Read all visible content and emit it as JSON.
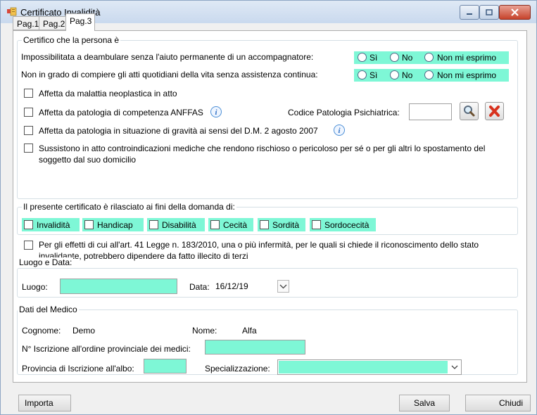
{
  "window": {
    "title": "Certificato Invalidità"
  },
  "tabs": [
    "Pag.1",
    "Pag.2",
    "Pag.3"
  ],
  "certifico": {
    "group_title": "Certifico che la persona è",
    "question1": "Impossibilitata a deambulare senza l'aiuto permanente di un accompagnatore:",
    "question2": "Non in grado di compiere gli atti quotidiani della vita senza assistenza continua:",
    "radio_options": [
      "Sì",
      "No",
      "Non mi esprimo"
    ],
    "check1": "Affetta da malattia neoplastica in atto",
    "check2": "Affetta da patologia di competenza ANFFAS",
    "codice_label": "Codice Patologia Psichiatrica:",
    "codice_value": "",
    "check3": "Affetta da patologia in situazione di gravità ai sensi del D.M. 2 agosto 2007",
    "check4_line1": "Sussistono in atto controindicazioni mediche che rendono rischioso o pericoloso per sé o per gli altri lo spostamento del",
    "check4_line2": "soggetto dal suo domicilio"
  },
  "domanda": {
    "group_title": "Il presente certificato è rilasciato ai fini della domanda di:",
    "options": [
      "Invalidità",
      "Handicap",
      "Disabilità",
      "Cecità",
      "Sordità",
      "Sordocecità"
    ]
  },
  "art41": {
    "line1": "Per gli effetti di cui all'art. 41 Legge n. 183/2010, una o più infermità, per le quali si chiede il riconoscimento dello stato",
    "line2": "invalidante, potrebbero dipendere da fatto illecito di terzi"
  },
  "luogo_data": {
    "group_title": "Luogo e Data:",
    "luogo_label": "Luogo:",
    "luogo_value": "",
    "data_label": "Data:",
    "data_value": "16/12/19"
  },
  "medico": {
    "group_title": "Dati del Medico",
    "cognome_label": "Cognome:",
    "cognome_value": "Demo",
    "nome_label": "Nome:",
    "nome_value": "Alfa",
    "iscrizione_label": "N° Iscrizione all'ordine provinciale dei medici:",
    "iscrizione_value": "",
    "provincia_label": "Provincia di Iscrizione all'albo:",
    "provincia_value": "",
    "specializzazione_label": "Specializzazione:",
    "specializzazione_value": ""
  },
  "buttons": {
    "importa": "Importa",
    "salva": "Salva",
    "chiudi": "Chiudi"
  },
  "colors": {
    "highlight": "#7ef7d6",
    "titlebar": "#c9d9ee",
    "close": "#c7432b"
  }
}
